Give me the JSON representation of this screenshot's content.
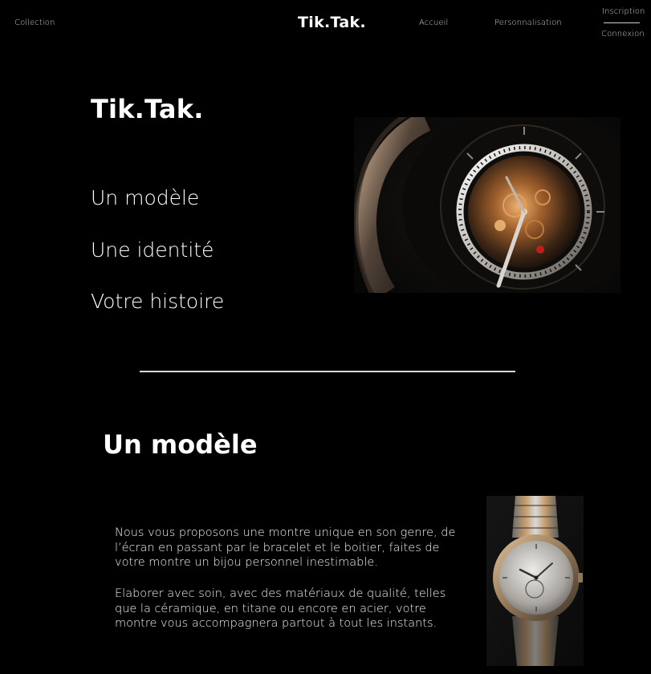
{
  "nav": {
    "collection": "Collection",
    "brand": "Tik.Tak.",
    "home": "Accueil",
    "customization": "Personnalisation",
    "signup": "Inscription",
    "login": "Connexion"
  },
  "hero": {
    "title": "Tik.Tak.",
    "taglines": [
      "Un modèle",
      "Une identité",
      "Votre histoire"
    ]
  },
  "section": {
    "title": "Un modèle",
    "paragraphs": [
      "Nous vous proposons une montre unique en son genre, de l’écran en passant par le bracelet et le boitier, faites de votre montre un bijou personnel inestimable.",
      "Elaborer avec soin, avec des matériaux de qualité, telles que la céramique, en titane ou encore en acier, votre montre vous accompagnera partout à tout les instants."
    ]
  },
  "colors": {
    "background": "#000000",
    "text": "#ffffff",
    "nav_text": "#cfcfcf",
    "divider": "#d8d8d8"
  },
  "images": {
    "hero": "skeleton-watch-dial-photo",
    "product": "two-tone-wristwatch-photo"
  }
}
